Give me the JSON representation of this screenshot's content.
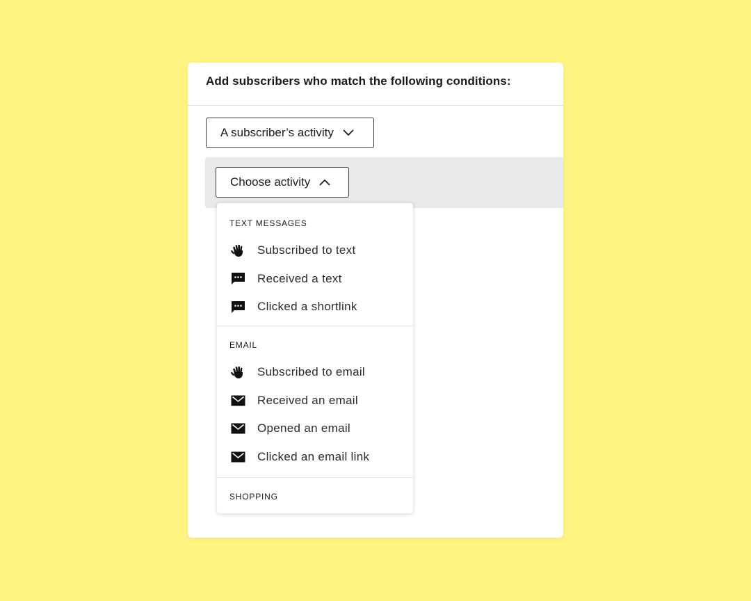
{
  "card": {
    "title": "Add subscribers who match the following conditions:"
  },
  "condition_dropdown": {
    "label": "A subscriber’s activity",
    "icon": "chevron-down-icon"
  },
  "activity_dropdown": {
    "label": "Choose activity",
    "icon": "chevron-up-icon",
    "expanded": true
  },
  "menu": {
    "sections": [
      {
        "heading": "TEXT MESSAGES",
        "items": [
          {
            "label": "Subscribed to text",
            "icon": "hand-wave-icon"
          },
          {
            "label": "Received a text",
            "icon": "chat-bubble-icon"
          },
          {
            "label": "Clicked a shortlink",
            "icon": "chat-bubble-icon"
          }
        ]
      },
      {
        "heading": "EMAIL",
        "items": [
          {
            "label": "Subscribed to email",
            "icon": "hand-wave-icon"
          },
          {
            "label": "Received an email",
            "icon": "envelope-icon"
          },
          {
            "label": "Opened an email",
            "icon": "envelope-icon"
          },
          {
            "label": "Clicked an email link",
            "icon": "envelope-icon"
          }
        ]
      },
      {
        "heading": "SHOPPING",
        "items": []
      }
    ]
  },
  "colors": {
    "background": "#fff382",
    "card": "#ffffff",
    "condition_row": "#e8e9e8",
    "text": "#1a1a1a"
  }
}
